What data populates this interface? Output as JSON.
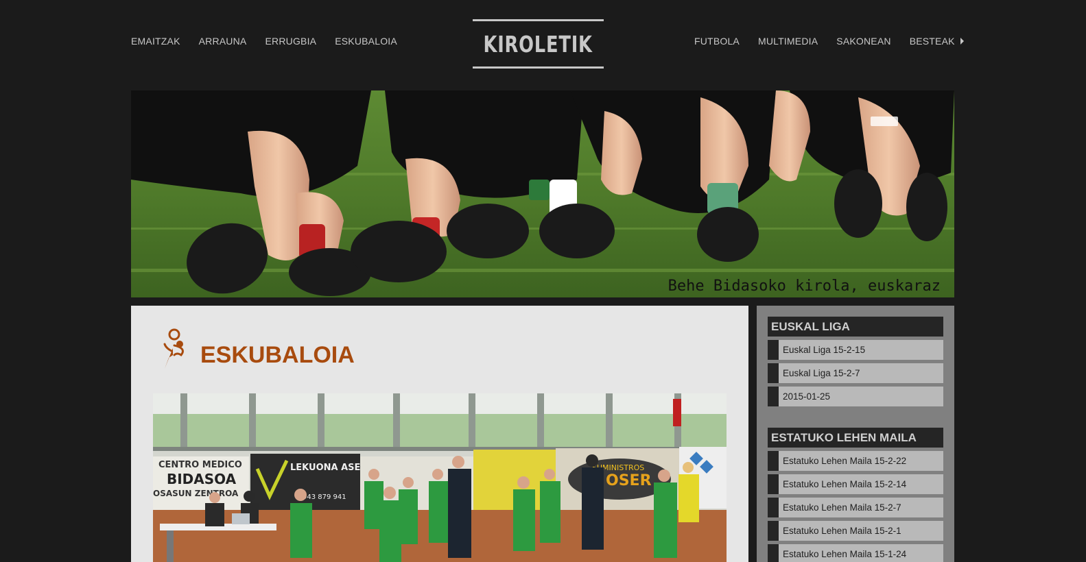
{
  "site": {
    "logo": "KIROLETIK",
    "tagline": "Behe Bidasoko kirola, euskaraz"
  },
  "nav_left": [
    "EMAITZAK",
    "ARRAUNA",
    "ERRUGBIA",
    "ESKUBALOIA"
  ],
  "nav_right": [
    "FUTBOLA",
    "MULTIMEDIA",
    "SAKONEAN",
    "BESTEAK"
  ],
  "main": {
    "section_title": "ESKUBALOIA",
    "icon": "handball-player-icon",
    "accent": "#a84b0e"
  },
  "sidebar": {
    "widgets": [
      {
        "title": "EUSKAL LIGA",
        "items": [
          "Euskal Liga 15-2-15",
          "Euskal Liga 15-2-7",
          "2015-01-25"
        ]
      },
      {
        "title": "ESTATUKO LEHEN MAILA",
        "items": [
          "Estatuko Lehen Maila 15-2-22",
          "Estatuko Lehen Maila 15-2-14",
          "Estatuko Lehen Maila 15-2-7",
          "Estatuko Lehen Maila 15-2-1",
          "Estatuko Lehen Maila 15-1-24"
        ]
      }
    ]
  },
  "photo_signs": {
    "s1": "CENTRO MEDICO",
    "s2": "BIDASOA",
    "s3": "OSASUN ZENTROA",
    "s4": "LEKUONA ASESORES",
    "s5": "943 879 941",
    "s6": "SUMINISTROS",
    "s7": "OSER"
  },
  "colors": {
    "background": "#1b1b1b",
    "sidebar": "#808080",
    "main": "#e6e6e6"
  }
}
